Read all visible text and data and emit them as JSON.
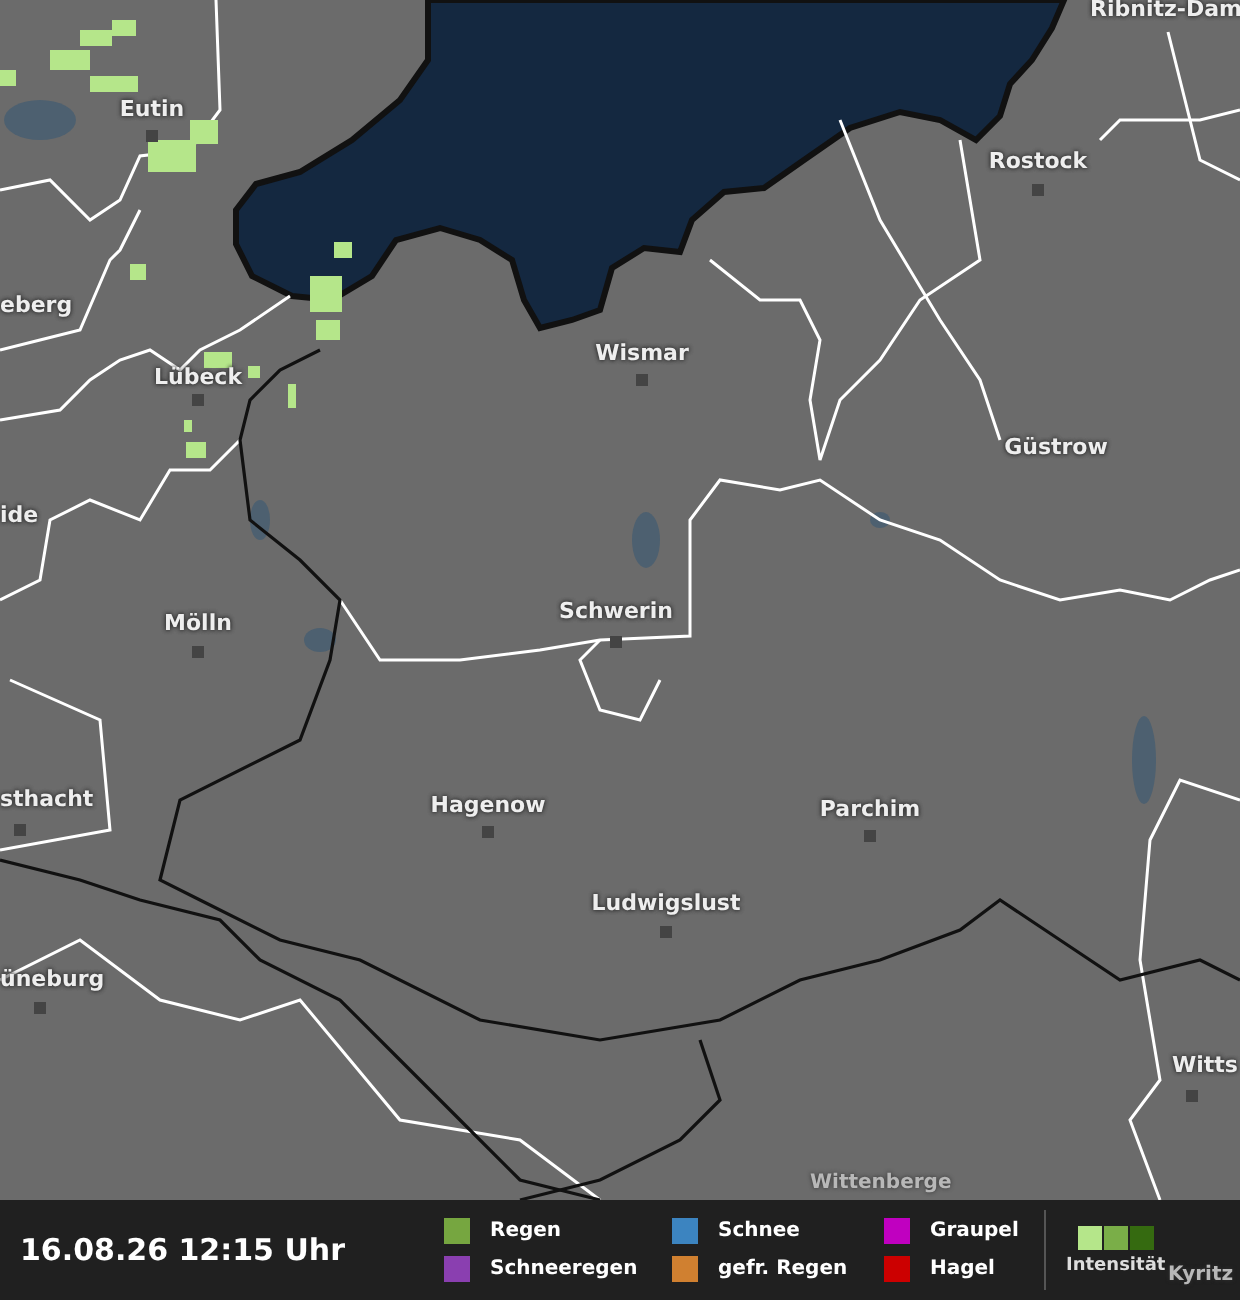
{
  "map": {
    "cities": [
      {
        "label": "Ribnitz-Dam",
        "kind": "cut"
      },
      {
        "label": "Eutin",
        "kind": "city"
      },
      {
        "label": "Rostock",
        "kind": "city"
      },
      {
        "label": "eberg",
        "kind": "cut"
      },
      {
        "label": "Wismar",
        "kind": "city"
      },
      {
        "label": "Lübeck",
        "kind": "city"
      },
      {
        "label": "Güstrow",
        "kind": "city"
      },
      {
        "label": "ide",
        "kind": "cut"
      },
      {
        "label": "Schwerin",
        "kind": "city"
      },
      {
        "label": "Mölln",
        "kind": "city"
      },
      {
        "label": "sthacht",
        "kind": "cut"
      },
      {
        "label": "Hagenow",
        "kind": "city"
      },
      {
        "label": "Parchim",
        "kind": "city"
      },
      {
        "label": "Ludwigslust",
        "kind": "city"
      },
      {
        "label": "üneburg",
        "kind": "cut"
      },
      {
        "label": "Witts",
        "kind": "cut"
      },
      {
        "label": "Wittenberge",
        "kind": "covered"
      },
      {
        "label": "Kyritz",
        "kind": "covered"
      }
    ]
  },
  "footer": {
    "timestamp": "16.08.26 12:15 Uhr",
    "legend": [
      {
        "label": "Regen",
        "color": "#76a640"
      },
      {
        "label": "Schnee",
        "color": "#3c84c0"
      },
      {
        "label": "Graupel",
        "color": "#c000c0"
      },
      {
        "label": "Schneeregen",
        "color": "#8a3fb0"
      },
      {
        "label": "gefr. Regen",
        "color": "#d08030"
      },
      {
        "label": "Hagel",
        "color": "#cc0000"
      }
    ],
    "intensity": {
      "label": "Intensität",
      "levels": [
        {
          "color": "#b5e68a"
        },
        {
          "color": "#7aae48"
        },
        {
          "color": "#356a10"
        }
      ]
    }
  }
}
